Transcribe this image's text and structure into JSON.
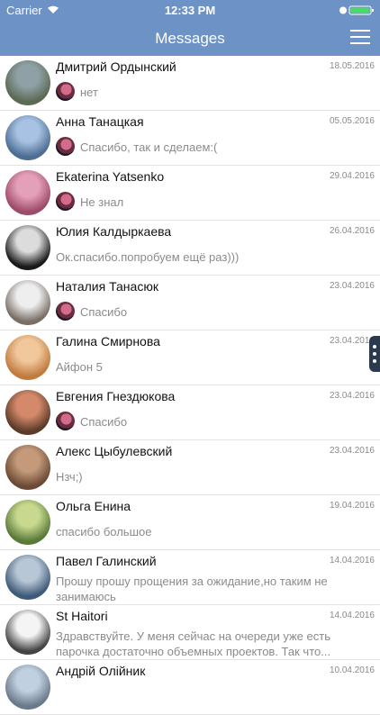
{
  "status": {
    "carrier": "Carrier",
    "time": "12:33 PM"
  },
  "nav": {
    "title": "Messages"
  },
  "conversations": [
    {
      "name": "Дмитрий Ордынский",
      "date": "18.05.2016",
      "message": "нет",
      "mini": true,
      "colors": [
        "#8fa0a6",
        "#5b6a52"
      ]
    },
    {
      "name": "Анна Танацкая",
      "date": "05.05.2016",
      "message": "Спасибо, так и сделаем:(",
      "mini": true,
      "colors": [
        "#a7c2e3",
        "#4d6d93"
      ]
    },
    {
      "name": "Ekaterina Yatsenko",
      "date": "29.04.2016",
      "message": "Не знал",
      "mini": true,
      "colors": [
        "#e3a0b8",
        "#9e4b6a"
      ]
    },
    {
      "name": "Юлия Калдыркаева",
      "date": "26.04.2016",
      "message": "Ок.спасибо.попробуем ещё раз)))",
      "mini": false,
      "colors": [
        "#dcdcdc",
        "#1a1a1a"
      ]
    },
    {
      "name": "Наталия Танасюк",
      "date": "23.04.2016",
      "message": "Спасибо",
      "mini": true,
      "colors": [
        "#eeeeee",
        "#7a6e66"
      ]
    },
    {
      "name": "Галина Смирнова",
      "date": "23.04.2016",
      "message": "Айфон 5",
      "mini": false,
      "colors": [
        "#f1c89c",
        "#c17b3f"
      ]
    },
    {
      "name": "Евгения Гнездюкова",
      "date": "23.04.2016",
      "message": "Спасибо",
      "mini": true,
      "colors": [
        "#d48a6a",
        "#5c3a2a"
      ]
    },
    {
      "name": "Алекс Цыбулевский",
      "date": "23.04.2016",
      "message": "Нзч;)",
      "mini": false,
      "colors": [
        "#c49a7a",
        "#6b4a35"
      ]
    },
    {
      "name": "Ольга Енина",
      "date": "19.04.2016",
      "message": "спасибо большое",
      "mini": false,
      "colors": [
        "#c8d88e",
        "#5a7a3a"
      ]
    },
    {
      "name": "Павел Галинский",
      "date": "14.04.2016",
      "message": "Прошу прошу прощения за ожидание,но таким не занимаюсь",
      "mini": false,
      "two": true,
      "colors": [
        "#b8c7d6",
        "#3e5a78"
      ]
    },
    {
      "name": "St Haitori",
      "date": "14.04.2016",
      "message": "Здравствуйте. У меня сейчас на очереди уже есть парочка достаточно объемных проектов. Так что...",
      "mini": false,
      "two": true,
      "colors": [
        "#f4f4f4",
        "#444444"
      ]
    },
    {
      "name": "Андрій Олійник",
      "date": "10.04.2016",
      "message": "",
      "mini": false,
      "colors": [
        "#c0d0e0",
        "#6a7a8a"
      ]
    }
  ]
}
